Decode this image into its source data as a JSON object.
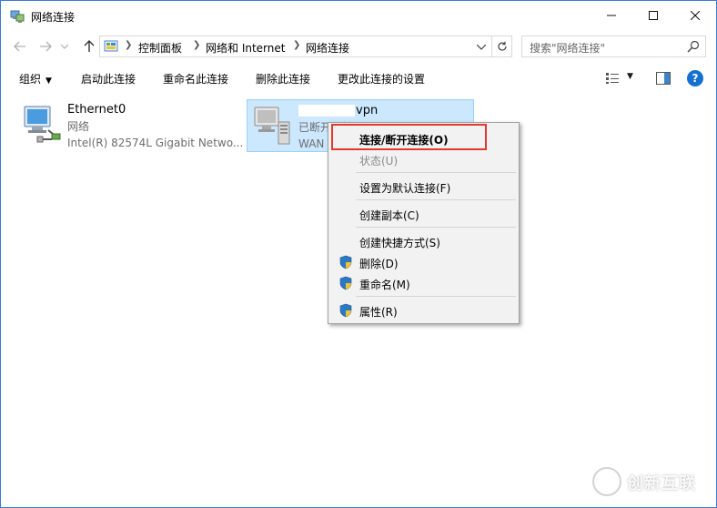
{
  "window": {
    "title": "网络连接",
    "controls": {
      "minimize": "—",
      "maximize": "☐",
      "close": "✕"
    }
  },
  "address": {
    "breadcrumb": [
      "控制面板",
      "网络和 Internet",
      "网络连接"
    ],
    "search_placeholder": "搜索\"网络连接\""
  },
  "toolbar": {
    "organize": "组织",
    "items": [
      "启动此连接",
      "重命名此连接",
      "删除此连接",
      "更改此连接的设置"
    ],
    "help": "?"
  },
  "connections": [
    {
      "name": "Ethernet0",
      "status": "网络",
      "device": "Intel(R) 82574L Gigabit Netwo..."
    },
    {
      "name": "vpn",
      "status": "已断开连接",
      "device": "WAN"
    }
  ],
  "context_menu": {
    "items": [
      {
        "label": "连接/断开连接(O)",
        "bold": true,
        "disabled": false,
        "shield": false
      },
      {
        "label": "状态(U)",
        "bold": false,
        "disabled": true,
        "shield": false
      },
      {
        "label": "设置为默认连接(F)",
        "bold": false,
        "disabled": false,
        "shield": false
      },
      {
        "label": "创建副本(C)",
        "bold": false,
        "disabled": false,
        "shield": false
      },
      {
        "label": "创建快捷方式(S)",
        "bold": false,
        "disabled": false,
        "shield": false
      },
      {
        "label": "删除(D)",
        "bold": false,
        "disabled": false,
        "shield": true
      },
      {
        "label": "重命名(M)",
        "bold": false,
        "disabled": false,
        "shield": true
      },
      {
        "label": "属性(R)",
        "bold": false,
        "disabled": false,
        "shield": true
      }
    ]
  },
  "watermark": {
    "text": "创新互联"
  },
  "colors": {
    "window_border": "#3a7bd5",
    "selection_bg": "#cce8ff",
    "selection_border": "#99d1ff",
    "highlight_red": "#e03a2e",
    "help_blue": "#1570d0"
  }
}
